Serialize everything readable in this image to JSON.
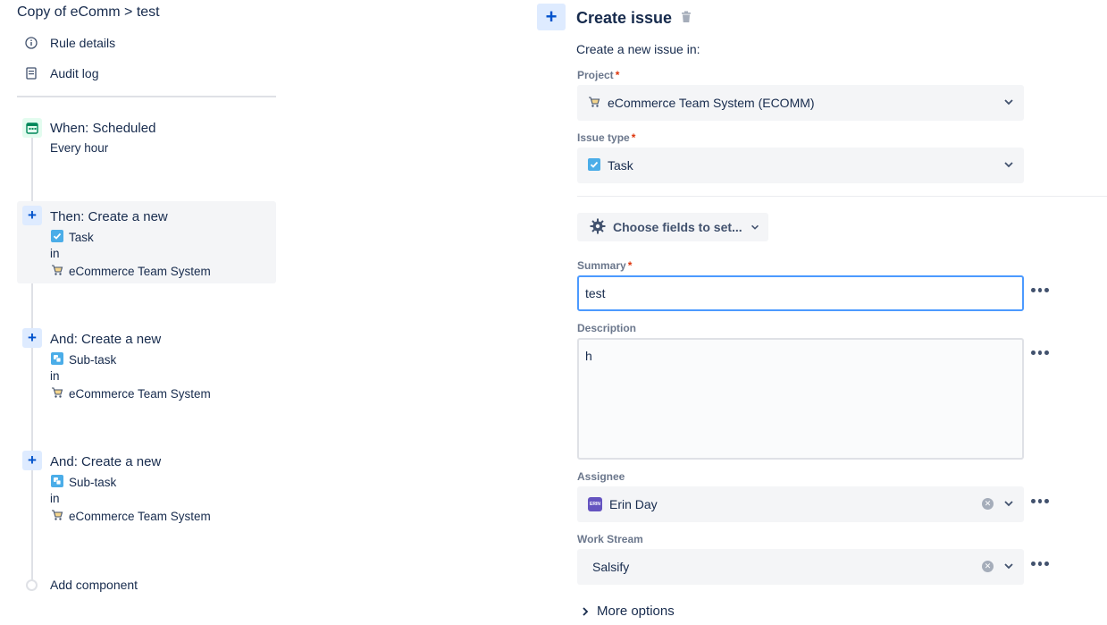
{
  "breadcrumb": "Copy of eComm > test",
  "nav": {
    "rule_details": "Rule details",
    "audit_log": "Audit log"
  },
  "components": [
    {
      "title": "When: Scheduled",
      "lines": [
        "Every hour"
      ]
    },
    {
      "title": "Then: Create a new",
      "issue_type": "Task",
      "in": "in",
      "project": "eCommerce Team System"
    },
    {
      "title": "And: Create a new",
      "issue_type": "Sub-task",
      "in": "in",
      "project": "eCommerce Team System"
    },
    {
      "title": "And: Create a new",
      "issue_type": "Sub-task",
      "in": "in",
      "project": "eCommerce Team System"
    }
  ],
  "add_component": "Add component",
  "action": {
    "title": "Create issue",
    "subtitle": "Create a new issue in:",
    "project_label": "Project",
    "project_value": "eCommerce Team System (ECOMM)",
    "issue_type_label": "Issue type",
    "issue_type_value": "Task",
    "choose_fields": "Choose fields to set...",
    "summary_label": "Summary",
    "summary_value": "test",
    "description_label": "Description",
    "description_value": "h",
    "assignee_label": "Assignee",
    "assignee_value": "Erin Day",
    "assignee_avatar_text": "ERIN",
    "workstream_label": "Work Stream",
    "workstream_value": "Salsify",
    "more_options": "More options"
  },
  "colors": {
    "accent": "#0052cc",
    "focus": "#4c9aff",
    "required": "#de350b"
  }
}
